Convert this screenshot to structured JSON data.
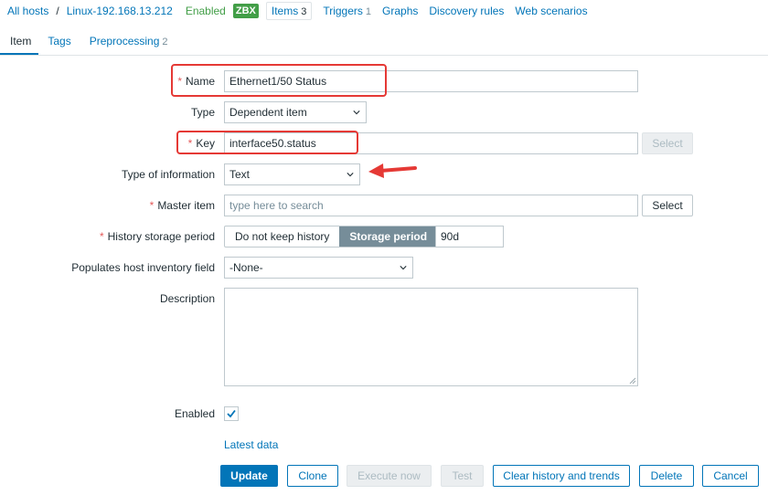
{
  "host_nav": {
    "all_hosts": "All hosts",
    "separator": "/",
    "host": "Linux-192.168.13.212",
    "status": "Enabled",
    "zbx": "ZBX",
    "tabs": [
      {
        "label": "Items",
        "count": "3"
      },
      {
        "label": "Triggers",
        "count": "1"
      },
      {
        "label": "Graphs",
        "count": ""
      },
      {
        "label": "Discovery rules",
        "count": ""
      },
      {
        "label": "Web scenarios",
        "count": ""
      }
    ]
  },
  "form_tabs": [
    {
      "label": "Item",
      "count": ""
    },
    {
      "label": "Tags",
      "count": ""
    },
    {
      "label": "Preprocessing",
      "count": "2"
    }
  ],
  "form": {
    "required_mark": "*",
    "name": {
      "label": "Name",
      "value": "Ethernet1/50 Status"
    },
    "type": {
      "label": "Type",
      "value": "Dependent item"
    },
    "key": {
      "label": "Key",
      "value": "interface50.status",
      "select_label": "Select"
    },
    "type_of_information": {
      "label": "Type of information",
      "value": "Text"
    },
    "master_item": {
      "label": "Master item",
      "placeholder": "type here to search",
      "select_label": "Select"
    },
    "history": {
      "label": "History storage period",
      "option_off": "Do not keep history",
      "option_on": "Storage period",
      "value": "90d"
    },
    "inventory": {
      "label": "Populates host inventory field",
      "value": "-None-"
    },
    "description": {
      "label": "Description",
      "value": ""
    },
    "enabled": {
      "label": "Enabled",
      "checked": true
    },
    "latest_data": "Latest data"
  },
  "buttons": {
    "update": "Update",
    "clone": "Clone",
    "execute_now": "Execute now",
    "test": "Test",
    "clear_history": "Clear history and trends",
    "delete": "Delete",
    "cancel": "Cancel"
  },
  "colors": {
    "link": "#0275b8",
    "enabled_green": "#429e47",
    "required_red": "#e45959",
    "annotation_red": "#e53935"
  },
  "icons": [
    "chevron-down-icon",
    "checkmark-icon",
    "resize-grip-icon",
    "arrow-annotation-icon"
  ]
}
